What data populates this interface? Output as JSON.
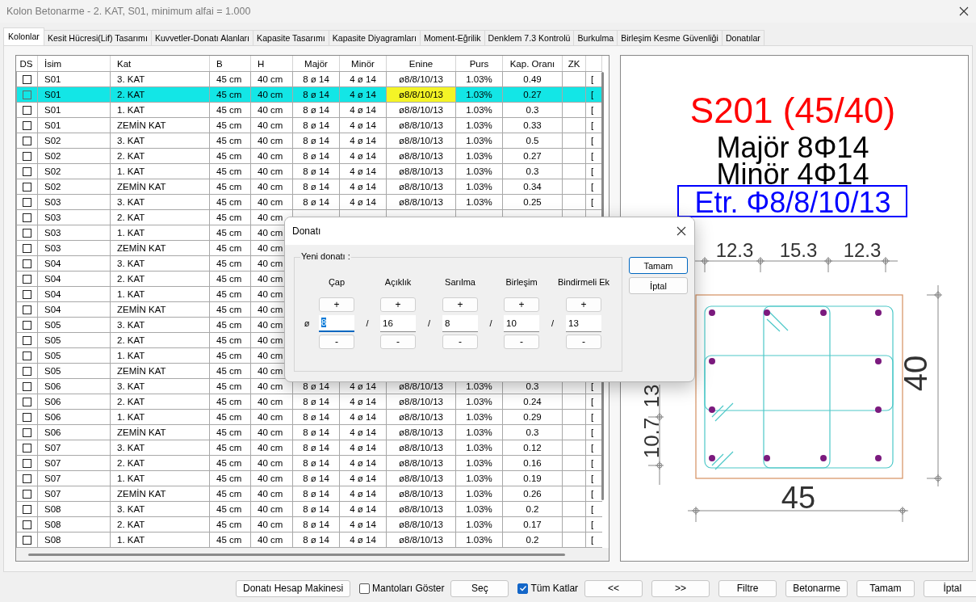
{
  "window": {
    "title": "Kolon Betonarme - 2. KAT, S01, minimum alfai = 1.000"
  },
  "tabs": [
    {
      "label": "Kolonlar",
      "selected": true
    },
    {
      "label": "Kesit Hücresi(Lif) Tasarımı",
      "selected": false
    },
    {
      "label": "Kuvvetler-Donatı Alanları",
      "selected": false
    },
    {
      "label": "Kapasite Tasarımı",
      "selected": false
    },
    {
      "label": "Kapasite Diyagramları",
      "selected": false
    },
    {
      "label": "Moment-Eğrilik",
      "selected": false
    },
    {
      "label": "Denklem 7.3 Kontrolü",
      "selected": false
    },
    {
      "label": "Burkulma",
      "selected": false
    },
    {
      "label": "Birleşim Kesme Güvenliği",
      "selected": false
    },
    {
      "label": "Donatılar",
      "selected": false
    }
  ],
  "table": {
    "checkbox_column": "DS",
    "columns": [
      "İsim",
      "Kat",
      "B",
      "H",
      "Majör",
      "Minör",
      "Enine",
      "Purs",
      "Kap. Oranı",
      "ZK"
    ],
    "rows": [
      {
        "checked": false,
        "selected": false,
        "flagged": false,
        "cells": [
          "S01",
          "3. KAT",
          "45 cm",
          "40 cm",
          "8 ø 14",
          "4 ø 14",
          "ø8/8/10/13",
          "1.03%",
          "0.49"
        ],
        "column_12": "["
      },
      {
        "checked": false,
        "selected": true,
        "flagged": true,
        "cells": [
          "S01",
          "2. KAT",
          "45 cm",
          "40 cm",
          "8 ø 14",
          "4 ø 14",
          "ø8/8/10/13",
          "1.03%",
          "0.27"
        ],
        "column_12": "["
      },
      {
        "checked": false,
        "selected": false,
        "flagged": false,
        "cells": [
          "S01",
          "1. KAT",
          "45 cm",
          "40 cm",
          "8 ø 14",
          "4 ø 14",
          "ø8/8/10/13",
          "1.03%",
          "0.3"
        ],
        "column_12": "["
      },
      {
        "checked": false,
        "selected": false,
        "flagged": false,
        "cells": [
          "S01",
          "ZEMİN KAT",
          "45 cm",
          "40 cm",
          "8 ø 14",
          "4 ø 14",
          "ø8/8/10/13",
          "1.03%",
          "0.33"
        ],
        "column_12": "["
      },
      {
        "checked": false,
        "selected": false,
        "flagged": false,
        "cells": [
          "S02",
          "3. KAT",
          "45 cm",
          "40 cm",
          "8 ø 14",
          "4 ø 14",
          "ø8/8/10/13",
          "1.03%",
          "0.5"
        ],
        "column_12": "["
      },
      {
        "checked": false,
        "selected": false,
        "flagged": false,
        "cells": [
          "S02",
          "2. KAT",
          "45 cm",
          "40 cm",
          "8 ø 14",
          "4 ø 14",
          "ø8/8/10/13",
          "1.03%",
          "0.27"
        ],
        "column_12": "["
      },
      {
        "checked": false,
        "selected": false,
        "flagged": false,
        "cells": [
          "S02",
          "1. KAT",
          "45 cm",
          "40 cm",
          "8 ø 14",
          "4 ø 14",
          "ø8/8/10/13",
          "1.03%",
          "0.3"
        ],
        "column_12": "["
      },
      {
        "checked": false,
        "selected": false,
        "flagged": false,
        "cells": [
          "S02",
          "ZEMİN KAT",
          "45 cm",
          "40 cm",
          "8 ø 14",
          "4 ø 14",
          "ø8/8/10/13",
          "1.03%",
          "0.34"
        ],
        "column_12": "["
      },
      {
        "checked": false,
        "selected": false,
        "flagged": false,
        "cells": [
          "S03",
          "3. KAT",
          "45 cm",
          "40 cm",
          "8 ø 14",
          "4 ø 14",
          "ø8/8/10/13",
          "1.03%",
          "0.25"
        ],
        "column_12": "["
      },
      {
        "checked": false,
        "selected": false,
        "cells": [
          "S03",
          "2. KAT",
          "45 cm",
          "40 cm"
        ]
      },
      {
        "checked": false,
        "selected": false,
        "cells": [
          "S03",
          "1. KAT",
          "45 cm",
          "40 cm"
        ]
      },
      {
        "checked": false,
        "selected": false,
        "cells": [
          "S03",
          "ZEMİN KAT",
          "45 cm",
          "40 cm"
        ]
      },
      {
        "checked": false,
        "selected": false,
        "cells": [
          "S04",
          "3. KAT",
          "45 cm",
          "40 cm"
        ]
      },
      {
        "checked": false,
        "selected": false,
        "cells": [
          "S04",
          "2. KAT",
          "45 cm",
          "40 cm"
        ]
      },
      {
        "checked": false,
        "selected": false,
        "cells": [
          "S04",
          "1. KAT",
          "45 cm",
          "40 cm"
        ]
      },
      {
        "checked": false,
        "selected": false,
        "cells": [
          "S04",
          "ZEMİN KAT",
          "45 cm",
          "40 cm"
        ]
      },
      {
        "checked": false,
        "selected": false,
        "cells": [
          "S05",
          "3. KAT",
          "45 cm",
          "40 cm"
        ]
      },
      {
        "checked": false,
        "selected": false,
        "cells": [
          "S05",
          "2. KAT",
          "45 cm",
          "40 cm"
        ]
      },
      {
        "checked": false,
        "selected": false,
        "cells": [
          "S05",
          "1. KAT",
          "45 cm",
          "40 cm"
        ]
      },
      {
        "checked": false,
        "selected": false,
        "cells": [
          "S05",
          "ZEMİN KAT",
          "45 cm",
          "40 cm"
        ]
      },
      {
        "checked": false,
        "selected": false,
        "flagged": false,
        "cells": [
          "S06",
          "3. KAT",
          "45 cm",
          "40 cm",
          "8 ø 14",
          "4 ø 14",
          "ø8/8/10/13",
          "1.03%",
          "0.3"
        ],
        "column_12": "["
      },
      {
        "checked": false,
        "selected": false,
        "flagged": false,
        "cells": [
          "S06",
          "2. KAT",
          "45 cm",
          "40 cm",
          "8 ø 14",
          "4 ø 14",
          "ø8/8/10/13",
          "1.03%",
          "0.24"
        ],
        "column_12": "["
      },
      {
        "checked": false,
        "selected": false,
        "flagged": false,
        "cells": [
          "S06",
          "1. KAT",
          "45 cm",
          "40 cm",
          "8 ø 14",
          "4 ø 14",
          "ø8/8/10/13",
          "1.03%",
          "0.29"
        ],
        "column_12": "["
      },
      {
        "checked": false,
        "selected": false,
        "flagged": false,
        "cells": [
          "S06",
          "ZEMİN KAT",
          "45 cm",
          "40 cm",
          "8 ø 14",
          "4 ø 14",
          "ø8/8/10/13",
          "1.03%",
          "0.3"
        ],
        "column_12": "["
      },
      {
        "checked": false,
        "selected": false,
        "flagged": false,
        "cells": [
          "S07",
          "3. KAT",
          "45 cm",
          "40 cm",
          "8 ø 14",
          "4 ø 14",
          "ø8/8/10/13",
          "1.03%",
          "0.12"
        ],
        "column_12": "["
      },
      {
        "checked": false,
        "selected": false,
        "flagged": false,
        "cells": [
          "S07",
          "2. KAT",
          "45 cm",
          "40 cm",
          "8 ø 14",
          "4 ø 14",
          "ø8/8/10/13",
          "1.03%",
          "0.16"
        ],
        "column_12": "["
      },
      {
        "checked": false,
        "selected": false,
        "flagged": false,
        "cells": [
          "S07",
          "1. KAT",
          "45 cm",
          "40 cm",
          "8 ø 14",
          "4 ø 14",
          "ø8/8/10/13",
          "1.03%",
          "0.19"
        ],
        "column_12": "["
      },
      {
        "checked": false,
        "selected": false,
        "flagged": false,
        "cells": [
          "S07",
          "ZEMİN KAT",
          "45 cm",
          "40 cm",
          "8 ø 14",
          "4 ø 14",
          "ø8/8/10/13",
          "1.03%",
          "0.26"
        ],
        "column_12": "["
      },
      {
        "checked": false,
        "selected": false,
        "flagged": false,
        "cells": [
          "S08",
          "3. KAT",
          "45 cm",
          "40 cm",
          "8 ø 14",
          "4 ø 14",
          "ø8/8/10/13",
          "1.03%",
          "0.2"
        ],
        "column_12": "["
      },
      {
        "checked": false,
        "selected": false,
        "flagged": false,
        "cells": [
          "S08",
          "2. KAT",
          "45 cm",
          "40 cm",
          "8 ø 14",
          "4 ø 14",
          "ø8/8/10/13",
          "1.03%",
          "0.17"
        ],
        "column_12": "["
      },
      {
        "checked": false,
        "selected": false,
        "flagged": false,
        "cells": [
          "S08",
          "1. KAT",
          "45 cm",
          "40 cm",
          "8 ø 14",
          "4 ø 14",
          "ø8/8/10/13",
          "1.03%",
          "0.2"
        ],
        "column_12": "["
      }
    ]
  },
  "drawing": {
    "title": "S201 (45/40)",
    "major": "Majör 8Φ14",
    "minor": "Minör 4Φ14",
    "stirrup": "Etr. Φ8/8/10/13",
    "top_dims": [
      "12.3",
      "15.3",
      "12.3"
    ],
    "height_dim": "40",
    "width_dim": "45",
    "left_dims": [
      "13",
      "10.7"
    ]
  },
  "dialog": {
    "title": "Donatı",
    "group": "Yeni donatı :",
    "prefix": "ø",
    "fields": [
      {
        "label": "Çap",
        "value": "8",
        "focused": true,
        "increment": "+",
        "decrement": "-"
      },
      {
        "label": "Açıklık",
        "value": "16",
        "focused": false,
        "separator": "/",
        "increment": "+",
        "decrement": "-"
      },
      {
        "label": "Sarılma",
        "value": "8",
        "focused": false,
        "separator": "/",
        "increment": "+",
        "decrement": "-"
      },
      {
        "label": "Birleşim",
        "value": "10",
        "focused": false,
        "separator": "/",
        "increment": "+",
        "decrement": "-"
      },
      {
        "label": "Bindirmeli Ek",
        "value": "13",
        "focused": false,
        "separator": "/",
        "increment": "+",
        "decrement": "-"
      }
    ],
    "buttons": [
      {
        "label": "Tamam",
        "default": true
      },
      {
        "label": "İptal",
        "default": false
      }
    ]
  },
  "toolbar": [
    {
      "kind": "button",
      "label": "Donatı Hesap Makinesi"
    },
    {
      "kind": "checkbox",
      "label": "Mantoları Göster",
      "checked": false
    },
    {
      "kind": "button",
      "label": "Seç"
    },
    {
      "kind": "checkbox",
      "label": "Tüm Katlar",
      "checked": true
    },
    {
      "kind": "button",
      "label": "<<"
    },
    {
      "kind": "button",
      "label": ">>"
    },
    {
      "kind": "button",
      "label": "Filtre"
    },
    {
      "kind": "button",
      "label": "Betonarme"
    },
    {
      "kind": "button",
      "label": "Tamam"
    },
    {
      "kind": "button",
      "label": "İptal"
    }
  ]
}
